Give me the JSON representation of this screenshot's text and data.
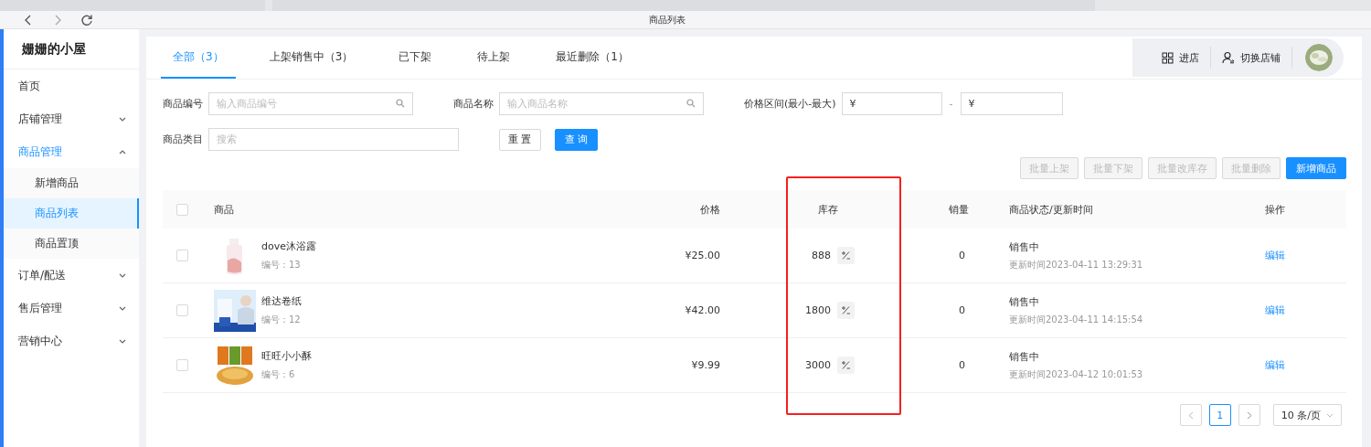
{
  "browser": {
    "title": "商品列表"
  },
  "sidebar": {
    "title": "姗姗的小屋",
    "items": [
      {
        "label": "首页",
        "kind": "link",
        "selected": false
      },
      {
        "label": "店铺管理",
        "kind": "group",
        "expanded": false,
        "selected": false
      },
      {
        "label": "商品管理",
        "kind": "group",
        "expanded": true,
        "selected": true,
        "children": [
          {
            "label": "新增商品",
            "selected": false
          },
          {
            "label": "商品列表",
            "selected": true
          },
          {
            "label": "商品置顶",
            "selected": false
          }
        ]
      },
      {
        "label": "订单/配送",
        "kind": "group",
        "expanded": false,
        "selected": false
      },
      {
        "label": "售后管理",
        "kind": "group",
        "expanded": false,
        "selected": false
      },
      {
        "label": "营销中心",
        "kind": "group",
        "expanded": false,
        "selected": false
      }
    ]
  },
  "tabs": [
    {
      "label": "全部（3）",
      "selected": true
    },
    {
      "label": "上架销售中（3）",
      "selected": false
    },
    {
      "label": "已下架",
      "selected": false
    },
    {
      "label": "待上架",
      "selected": false
    },
    {
      "label": "最近删除（1）",
      "selected": false
    }
  ],
  "header_actions": [
    {
      "label": "进店",
      "kind": "store"
    },
    {
      "label": "切换店铺",
      "kind": "switch"
    }
  ],
  "filters": {
    "code": {
      "label": "商品编号",
      "placeholder": "输入商品编号"
    },
    "name": {
      "label": "商品名称",
      "placeholder": "输入商品名称"
    },
    "price": {
      "label": "价格区间(最小-最大)",
      "min_prefix": "¥",
      "separator": "-",
      "max_prefix": "¥"
    },
    "category": {
      "label": "商品类目",
      "placeholder": "搜索"
    },
    "reset": "重 置",
    "query": "查 询"
  },
  "bulk_actions": [
    {
      "label": "批量上架",
      "disabled": true
    },
    {
      "label": "批量下架",
      "disabled": true
    },
    {
      "label": "批量改库存",
      "disabled": true
    },
    {
      "label": "批量删除",
      "disabled": true
    },
    {
      "label": "新增商品",
      "disabled": false
    }
  ],
  "table": {
    "all_checked": false,
    "columns": [
      "商品",
      "价格",
      "库存",
      "销量",
      "商品状态/更新时间",
      "操作"
    ],
    "rows": [
      {
        "name": "dove沐浴露",
        "code": "编号：13",
        "price": "¥25.00",
        "stock": "888",
        "sales": "0",
        "status": "销售中",
        "updated": "更新时间2023-04-11 13:29:31",
        "action": "编辑",
        "checked": false
      },
      {
        "name": "维达卷纸",
        "code": "编号：12",
        "price": "¥42.00",
        "stock": "1800",
        "sales": "0",
        "status": "销售中",
        "updated": "更新时间2023-04-11 14:15:54",
        "action": "编辑",
        "checked": false
      },
      {
        "name": "旺旺小小酥",
        "code": "编号：6",
        "price": "¥9.99",
        "stock": "3000",
        "sales": "0",
        "status": "销售中",
        "updated": "更新时间2023-04-12 10:01:53",
        "action": "编辑",
        "checked": false
      }
    ]
  },
  "pagination": {
    "pages": [
      {
        "label": "1",
        "selected": true
      }
    ],
    "page_size": "10 条/页"
  }
}
